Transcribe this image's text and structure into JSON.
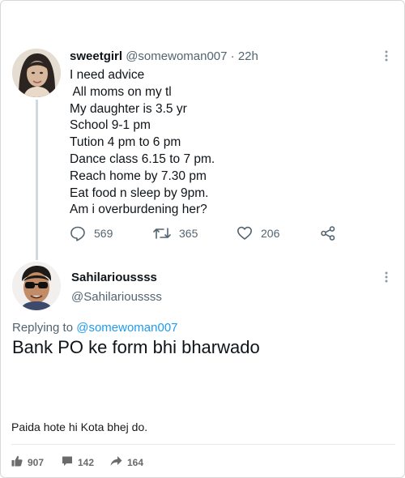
{
  "tweet": {
    "name": "sweetgirl",
    "handle": "@somewoman007",
    "time": "· 22h",
    "lines": [
      "I need advice",
      " All moms on my tl",
      "My daughter is 3.5 yr",
      "School 9-1 pm",
      "Tution 4 pm to 6 pm",
      "Dance class 6.15 to 7 pm.",
      "Reach home by 7.30 pm",
      "Eat food n sleep by 9pm.",
      "Am i overburdening her?"
    ],
    "replies": "569",
    "retweets": "365",
    "likes": "206",
    "icons": [
      "reply-icon",
      "retweet-icon",
      "like-icon",
      "share-icon",
      "more-icon"
    ]
  },
  "reply": {
    "name": "Sahilarioussss",
    "handle": "@Sahilarioussss",
    "replying_prefix": "Replying to",
    "replying_to": "@somewoman007",
    "text": "Bank PO ke form bhi bharwado"
  },
  "post": {
    "caption": "Paida hote hi Kota bhej do.",
    "upvotes": "907",
    "comments": "142",
    "shares": "164",
    "icons": [
      "thumbs-up-icon",
      "comment-icon",
      "share-arrow-icon"
    ]
  },
  "colors": {
    "link": "#1d9bf0",
    "muted": "#536471",
    "thread": "#cfd9de"
  }
}
